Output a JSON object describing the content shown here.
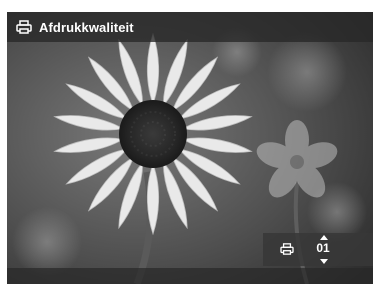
{
  "header": {
    "title": "Afdrukkwaliteit",
    "icon": "printer-icon"
  },
  "counter": {
    "value": "01",
    "icon": "printer-icon"
  },
  "colors": {
    "overlay": "#282828",
    "text": "#ffffff"
  }
}
